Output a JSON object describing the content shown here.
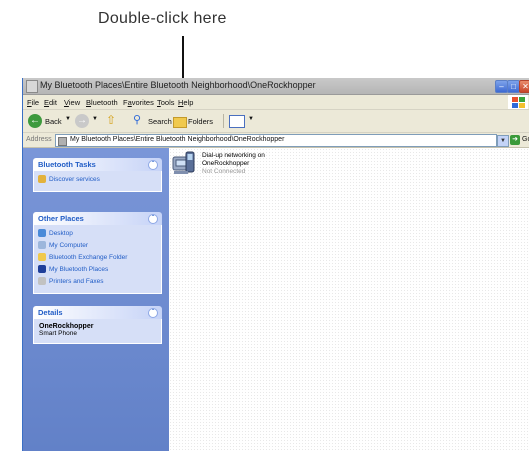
{
  "callout": {
    "text": "Double-click here"
  },
  "window": {
    "title": "My Bluetooth Places\\Entire Bluetooth Neighborhood\\OneRockhopper",
    "menu": [
      {
        "label": "File",
        "u": "F",
        "rest": "ile"
      },
      {
        "label": "Edit",
        "u": "E",
        "rest": "dit"
      },
      {
        "label": "View",
        "u": "V",
        "rest": "iew"
      },
      {
        "label": "Bluetooth",
        "u": "B",
        "rest": "luetooth"
      },
      {
        "label": "Favorites",
        "u": "",
        "rest": "Favorites"
      },
      {
        "label": "Tools",
        "u": "T",
        "rest": "ools"
      },
      {
        "label": "Help",
        "u": "H",
        "rest": "elp"
      }
    ],
    "toolbar": {
      "back": "Back",
      "search": "Search",
      "folders": "Folders"
    },
    "address": {
      "label": "Address",
      "value": "My Bluetooth Places\\Entire Bluetooth Neighborhood\\OneRockhopper",
      "go": "Go"
    }
  },
  "sidebar": {
    "tasks": {
      "title": "Bluetooth Tasks",
      "items": [
        "Discover services"
      ]
    },
    "places": {
      "title": "Other Places",
      "items": [
        "Desktop",
        "My Computer",
        "Bluetooth Exchange Folder",
        "My Bluetooth Places",
        "Printers and Faxes"
      ]
    },
    "details": {
      "title": "Details",
      "name": "OneRockhopper",
      "type": "Smart Phone"
    }
  },
  "content": {
    "service": {
      "line1": "Dial-up networking on",
      "line2": "OneRockhopper",
      "status": "Not Connected"
    }
  },
  "colors": {
    "accent": "#215dc6",
    "sidebar": "#6281c8",
    "panel": "#d6dff7"
  }
}
